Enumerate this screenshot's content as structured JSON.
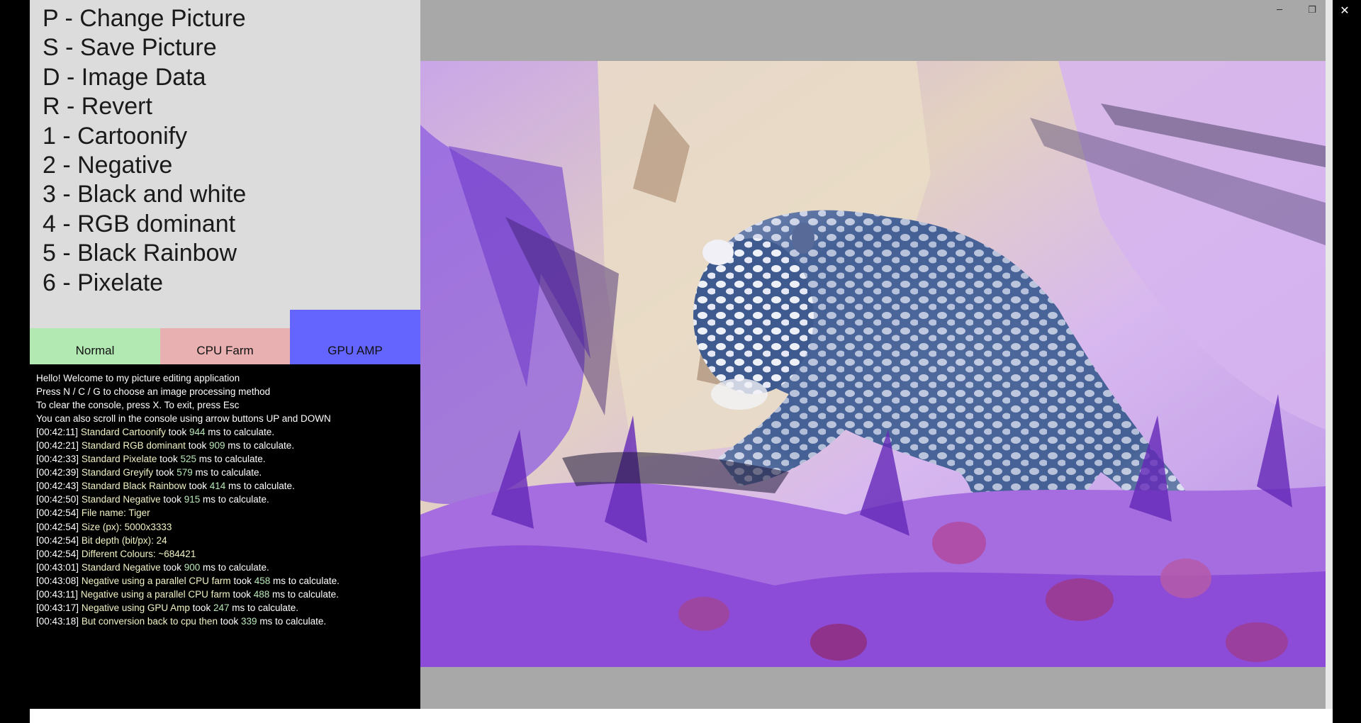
{
  "menu": {
    "items": [
      "P - Change Picture",
      "S - Save Picture",
      "D - Image Data",
      "R - Revert",
      "1 - Cartoonify",
      "2 - Negative",
      "3 - Black and white",
      "4 - RGB dominant",
      "5 - Black Rainbow",
      "6 - Pixelate"
    ]
  },
  "modes": {
    "normal": "Normal",
    "cpu": "CPU Farm",
    "gpu": "GPU AMP",
    "selected": "GPU AMP",
    "colors": {
      "normal": "#b2e8b2",
      "cpu": "#e8b0b0",
      "gpu": "#6464ff"
    }
  },
  "console": {
    "intro": [
      "Hello! Welcome to my picture editing application",
      "Press N / C / G to choose an image processing method",
      "To clear the console, press X. To exit, press Esc",
      "You can also scroll in the console using arrow buttons UP and DOWN"
    ],
    "entries": [
      {
        "time": "[00:42:11]",
        "msg": "Standard Cartoonify",
        "mid": "took",
        "num": "944",
        "tail": "ms to calculate."
      },
      {
        "time": "[00:42:21]",
        "msg": "Standard RGB dominant",
        "mid": "took",
        "num": "909",
        "tail": "ms to calculate."
      },
      {
        "time": "[00:42:33]",
        "msg": "Standard Pixelate",
        "mid": "took",
        "num": "525",
        "tail": "ms to calculate."
      },
      {
        "time": "[00:42:39]",
        "msg": "Standard Greyify",
        "mid": "took",
        "num": "579",
        "tail": "ms to calculate."
      },
      {
        "time": "[00:42:43]",
        "msg": "Standard Black Rainbow",
        "mid": "took",
        "num": "414",
        "tail": "ms to calculate."
      },
      {
        "time": "[00:42:50]",
        "msg": "Standard Negative",
        "mid": "took",
        "num": "915",
        "tail": "ms to calculate."
      },
      {
        "time": "[00:42:54]",
        "msg": "File name:",
        "mid": "",
        "num": "",
        "tail": "Tiger"
      },
      {
        "time": "[00:42:54]",
        "msg": "Size (px):",
        "mid": "",
        "num": "",
        "tail": "5000x3333"
      },
      {
        "time": "[00:42:54]",
        "msg": "Bit depth (bit/px):",
        "mid": "",
        "num": "",
        "tail": "24"
      },
      {
        "time": "[00:42:54]",
        "msg": "Different Colours:",
        "mid": "",
        "num": "",
        "tail": "~684421"
      },
      {
        "time": "[00:43:01]",
        "msg": "Standard Negative",
        "mid": "took",
        "num": "900",
        "tail": "ms to calculate."
      },
      {
        "time": "[00:43:08]",
        "msg": "Negative using a parallel CPU farm",
        "mid": "took",
        "num": "458",
        "tail": "ms to calculate."
      },
      {
        "time": "[00:43:11]",
        "msg": "Negative using a parallel CPU farm",
        "mid": "took",
        "num": "488",
        "tail": "ms to calculate."
      },
      {
        "time": "[00:43:17]",
        "msg": "Negative using GPU Amp",
        "mid": "took",
        "num": "247",
        "tail": "ms to calculate."
      },
      {
        "time": "[00:43:18]",
        "msg": "But conversion back to cpu then",
        "mid": "took",
        "num": "339",
        "tail": "ms to calculate."
      }
    ]
  },
  "window_controls": {
    "minimize": "─",
    "maximize": "❐",
    "close": "✕"
  },
  "icons": {
    "minimize": "minimize-icon",
    "maximize": "restore-icon",
    "close": "close-icon"
  },
  "image": {
    "name": "Tiger",
    "effect": "Negative"
  }
}
